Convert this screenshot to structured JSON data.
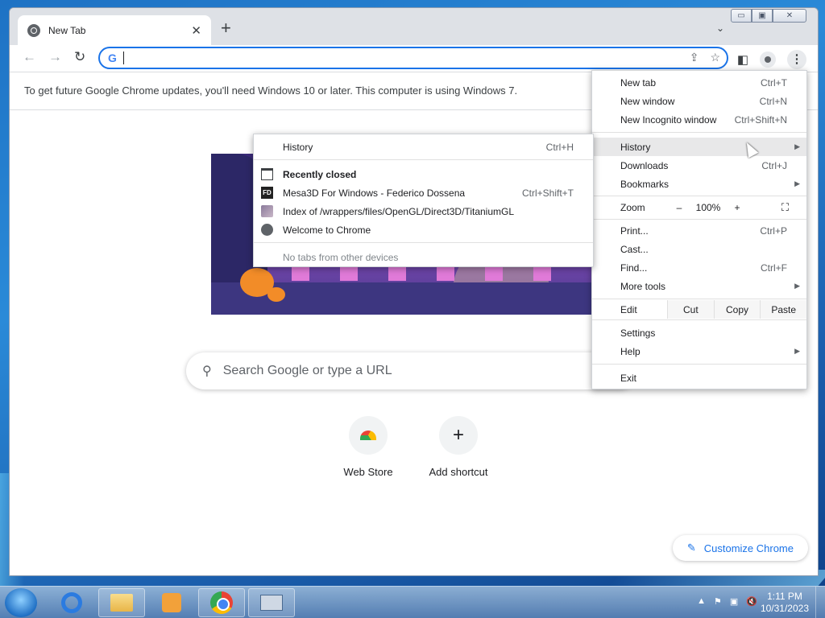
{
  "browser": {
    "tab": {
      "title": "New Tab",
      "close": "✕"
    },
    "new_tab_glyph": "+",
    "tab_list_glyph": "⌄",
    "window_controls": {
      "minimize": "▭",
      "maximize": "▣",
      "close": "✕"
    },
    "nav": {
      "back": "←",
      "forward": "→",
      "reload": "↻"
    },
    "omnibox": {
      "logo": "G",
      "value": ""
    },
    "toolbar_icons": [
      "share-icon",
      "star-icon",
      "side-panel-icon",
      "profile-icon",
      "kebab-menu-icon"
    ]
  },
  "infobar": {
    "message": "To get future Google Chrome updates, you'll need Windows 10 or later. This computer is using Windows 7."
  },
  "ntp": {
    "search_placeholder": "Search Google or type a URL",
    "shortcuts": [
      {
        "label": "Web Store",
        "icon": "web-store-icon"
      },
      {
        "label": "Add shortcut",
        "icon": "plus-icon"
      }
    ],
    "customize_label": "Customize Chrome"
  },
  "main_menu": {
    "new_tab": {
      "label": "New tab",
      "shortcut": "Ctrl+T"
    },
    "new_window": {
      "label": "New window",
      "shortcut": "Ctrl+N"
    },
    "new_incognito": {
      "label": "New Incognito window",
      "shortcut": "Ctrl+Shift+N"
    },
    "history": {
      "label": "History"
    },
    "downloads": {
      "label": "Downloads",
      "shortcut": "Ctrl+J"
    },
    "bookmarks": {
      "label": "Bookmarks"
    },
    "zoom": {
      "label": "Zoom",
      "minus": "–",
      "value": "100%",
      "plus": "+"
    },
    "print": {
      "label": "Print...",
      "shortcut": "Ctrl+P"
    },
    "cast": {
      "label": "Cast..."
    },
    "find": {
      "label": "Find...",
      "shortcut": "Ctrl+F"
    },
    "more_tools": {
      "label": "More tools"
    },
    "edit": {
      "label": "Edit",
      "cut": "Cut",
      "copy": "Copy",
      "paste": "Paste"
    },
    "settings": {
      "label": "Settings"
    },
    "help": {
      "label": "Help"
    },
    "exit": {
      "label": "Exit"
    }
  },
  "history_menu": {
    "history": {
      "label": "History",
      "shortcut": "Ctrl+H"
    },
    "recently_closed": "Recently closed",
    "items": [
      {
        "label": "Mesa3D For Windows - Federico Dossena",
        "shortcut": "Ctrl+Shift+T",
        "icon": "fd-favicon",
        "icon_text": "FD"
      },
      {
        "label": "Index of /wrappers/files/OpenGL/Direct3D/TitaniumGL",
        "shortcut": "",
        "icon": "image-favicon"
      },
      {
        "label": "Welcome to Chrome",
        "shortcut": "",
        "icon": "globe-icon"
      }
    ],
    "no_tabs": "No tabs from other devices"
  },
  "taskbar": {
    "items": [
      "start-orb-icon",
      "internet-explorer-icon",
      "windows-explorer-icon",
      "media-player-icon",
      "chrome-icon",
      "on-screen-keyboard-icon"
    ],
    "tray_icons": [
      "show-hidden-icons",
      "action-center-icon",
      "network-icon",
      "volume-muted-icon"
    ],
    "time": "1:11 PM",
    "date": "10/31/2023"
  }
}
